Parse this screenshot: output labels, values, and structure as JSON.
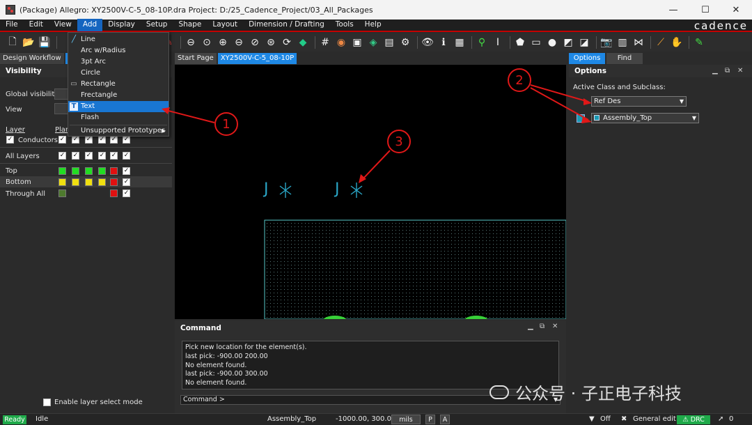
{
  "window": {
    "title": "(Package) Allegro: XY2500V-C-5_08-10P.dra  Project: D:/25_Cadence_Project/03_All_Packages",
    "controls": {
      "minimize": "—",
      "maximize": "☐",
      "close": "✕"
    }
  },
  "menubar": {
    "items": [
      "File",
      "Edit",
      "View",
      "Add",
      "Display",
      "Setup",
      "Shape",
      "Layout",
      "Dimension / Drafting",
      "Tools",
      "Help"
    ],
    "active": "Add",
    "logo": "cadence"
  },
  "add_menu": {
    "items": [
      {
        "label": "Line",
        "icon": "line-icon"
      },
      {
        "label": "Arc w/Radius",
        "icon": ""
      },
      {
        "label": "3pt Arc",
        "icon": ""
      },
      {
        "label": "Circle",
        "icon": ""
      },
      {
        "label": "Rectangle",
        "icon": "rectangle-icon"
      },
      {
        "label": "Frectangle",
        "icon": ""
      },
      {
        "label": "Text",
        "icon": "text-icon"
      },
      {
        "label": "Flash",
        "icon": ""
      },
      {
        "label": "Unsupported Prototypes",
        "icon": ""
      }
    ],
    "highlighted": "Text"
  },
  "left_tabs": [
    "Design Workflow",
    "V"
  ],
  "visibility": {
    "header": "Visibility",
    "global_label": "Global visibility",
    "view_label": "View",
    "layer_col": "Layer",
    "plan_col": "Plan",
    "rows": [
      {
        "name": "Conductors",
        "checked": true
      },
      {
        "name": "All Layers"
      },
      {
        "name": "Top",
        "colors": [
          "#22dd22",
          "#22dd22",
          "#22dd22",
          "#22dd22",
          "#e01010"
        ]
      },
      {
        "name": "Bottom",
        "colors": [
          "#f0e010",
          "#f0e010",
          "#f0e010",
          "#f0e010",
          "#e01010"
        ]
      },
      {
        "name": "Through All",
        "colors": [
          "#4e7a2e",
          "",
          "",
          "",
          "#e01010"
        ]
      }
    ],
    "enable_layer_select": "Enable layer select mode"
  },
  "doc_tabs": [
    "Start Page",
    "XY2500V-C-5_08-10P"
  ],
  "command": {
    "title": "Command",
    "lines": [
      "Pick new location for the element(s).",
      "last pick:  -900.00 200.00",
      "No element found.",
      "last pick:  -900.00 300.00",
      "No element found."
    ],
    "prompt": "Command >"
  },
  "right_tabs": [
    "Options",
    "Find"
  ],
  "options": {
    "header": "Options",
    "active_label": "Active Class and Subclass:",
    "class_value": "Ref Des",
    "subclass_value": "Assembly_Top",
    "color": "#1a9ab4"
  },
  "canvas": {
    "ref_text": "J",
    "annotations": [
      "1",
      "2",
      "3"
    ],
    "arrow_color": "#e01818"
  },
  "statusbar": {
    "ready": "Ready",
    "idle": "Idle",
    "subclass": "Assembly_Top",
    "coords": "-1000.00, 300.00",
    "units": "mils",
    "p": "P",
    "a": "A",
    "off": "Off",
    "edit_mode": "General edit",
    "drc": "DRC",
    "count": "0"
  },
  "watermark": "公众号 · 子正电子科技"
}
